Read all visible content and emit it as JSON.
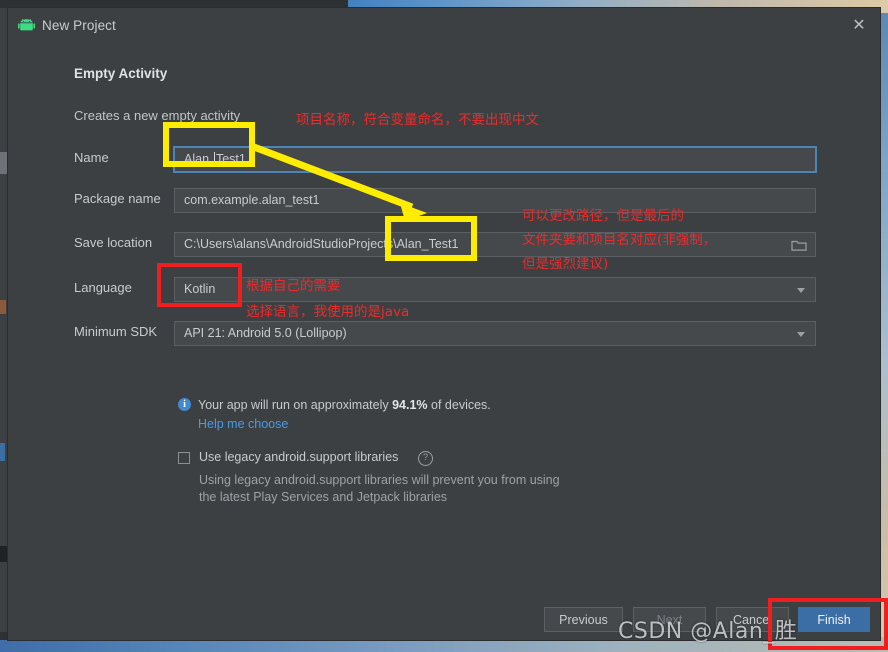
{
  "window": {
    "title": "New Project",
    "app_icon": "android-robot-icon",
    "close_label": "✕"
  },
  "dialog": {
    "heading": "Empty Activity",
    "subheading": "Creates a new empty activity"
  },
  "form": {
    "fields": [
      {
        "id": "name",
        "label": "Name",
        "value": "Alan_Test1",
        "control": "text",
        "focused": true
      },
      {
        "id": "package",
        "label": "Package name",
        "value": "com.example.alan_test1",
        "control": "text",
        "focused": false
      },
      {
        "id": "save",
        "label": "Save location",
        "value": "C:\\Users\\alans\\AndroidStudioProjects\\Alan_Test1",
        "control": "path",
        "focused": false
      },
      {
        "id": "language",
        "label": "Language",
        "value": "Kotlin",
        "control": "combo",
        "focused": false
      },
      {
        "id": "min_sdk",
        "label": "Minimum SDK",
        "value": "API 21: Android 5.0 (Lollipop)",
        "control": "combo",
        "focused": false
      }
    ]
  },
  "info": {
    "icon": "info-icon",
    "icon_glyph": "i",
    "text_prefix": "Your app will run on approximately ",
    "percent": "94.1%",
    "text_suffix": " of devices.",
    "link": "Help me choose"
  },
  "legacy": {
    "checkbox_checked": false,
    "label": "Use legacy android.support libraries",
    "help_glyph": "?",
    "description_line1": "Using legacy android.support libraries will prevent you from using",
    "description_line2": "the latest Play Services and Jetpack libraries"
  },
  "footer": {
    "previous": "Previous",
    "next": "Next",
    "cancel": "Cancel",
    "finish": "Finish"
  },
  "annotations": {
    "name_note": "项目名称，符合变量命名，不要出现中文",
    "path_note_1": "可以更改路径，但是最后的",
    "path_note_2": "文件夹要和项目名对应(非强制，",
    "path_note_3": "但是强烈建议)",
    "lang_note_1": "根据自己的需要",
    "lang_note_2": "选择语言，我使用的是java",
    "highlight_color": "#ffed00",
    "box_color": "#f01e1e",
    "text_color": "#ef2a2a"
  },
  "watermark": {
    "text": "CSDN @Alan_胜"
  }
}
